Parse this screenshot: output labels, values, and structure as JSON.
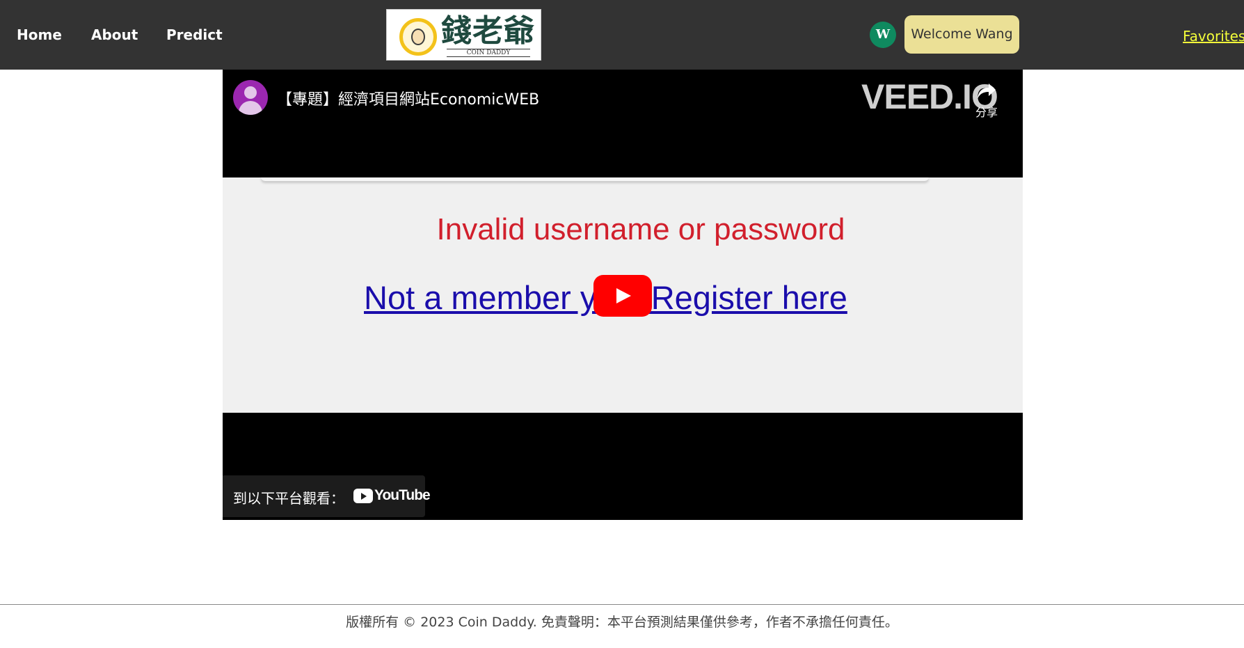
{
  "nav": {
    "links": [
      "Home",
      "About",
      "Predict"
    ],
    "logo_text": "錢老爺",
    "logo_subtitle": "COIN DADDY",
    "avatar_letter": "W",
    "welcome_label": "Welcome Wang",
    "favorites_label": "Favorites"
  },
  "video": {
    "title": "【專題】經濟項目網站EconomicWEB",
    "watermark": "VEED.IO",
    "share_label": "分享",
    "frame_error": "Invalid username or password",
    "frame_link": "Not a member yet? Register here",
    "watch_on_label": "到以下平台觀看：",
    "youtube_label": "YouTube"
  },
  "footer": {
    "text": "版權所有 © 2023 Coin Daddy. 免責聲明：本平台預測結果僅供參考，作者不承擔任何責任。"
  },
  "colors": {
    "navbar_bg": "#333333",
    "welcome_bg": "#ebe096",
    "favorites": "#f4ff3a",
    "avatar_bg": "#0f8a5f",
    "play_red": "#ff0000",
    "error_red": "#d11f2c"
  },
  "icons": [
    "user-icon",
    "share-icon",
    "play-icon",
    "youtube-logo-icon",
    "coin-logo-icon"
  ]
}
